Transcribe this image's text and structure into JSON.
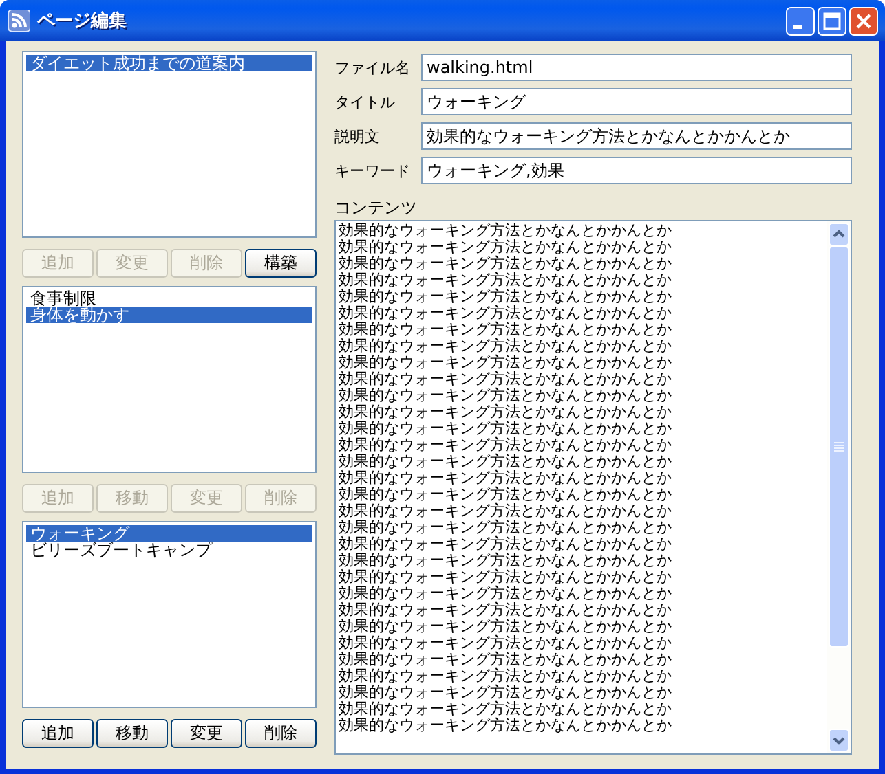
{
  "window": {
    "title": "ページ編集"
  },
  "lists": [
    {
      "items": [
        {
          "label": "ダイエット成功までの道案内",
          "selected": true
        }
      ],
      "buttons": [
        {
          "label": "追加",
          "disabled": true
        },
        {
          "label": "変更",
          "disabled": true
        },
        {
          "label": "削除",
          "disabled": true
        },
        {
          "label": "構築",
          "disabled": false
        }
      ]
    },
    {
      "items": [
        {
          "label": "食事制限",
          "selected": false
        },
        {
          "label": "身体を動かす",
          "selected": true
        }
      ],
      "buttons": [
        {
          "label": "追加",
          "disabled": true
        },
        {
          "label": "移動",
          "disabled": true
        },
        {
          "label": "変更",
          "disabled": true
        },
        {
          "label": "削除",
          "disabled": true
        }
      ]
    },
    {
      "items": [
        {
          "label": "ウォーキング",
          "selected": true
        },
        {
          "label": "ビリーズブートキャンプ",
          "selected": false
        }
      ],
      "buttons": [
        {
          "label": "追加",
          "disabled": false
        },
        {
          "label": "移動",
          "disabled": false
        },
        {
          "label": "変更",
          "disabled": false
        },
        {
          "label": "削除",
          "disabled": false
        }
      ]
    }
  ],
  "fields": [
    {
      "label": "ファイル名",
      "value": "walking.html"
    },
    {
      "label": "タイトル",
      "value": "ウォーキング"
    },
    {
      "label": "説明文",
      "value": "効果的なウォーキング方法とかなんとかかんとか"
    },
    {
      "label": "キーワード",
      "value": "ウォーキング,効果"
    }
  ],
  "content": {
    "label": "コンテンツ",
    "lines": [
      "効果的なウォーキング方法とかなんとかかんとか",
      "効果的なウォーキング方法とかなんとかかんとか",
      "効果的なウォーキング方法とかなんとかかんとか",
      "効果的なウォーキング方法とかなんとかかんとか",
      "効果的なウォーキング方法とかなんとかかんとか",
      "効果的なウォーキング方法とかなんとかかんとか",
      "効果的なウォーキング方法とかなんとかかんとか",
      "効果的なウォーキング方法とかなんとかかんとか",
      "効果的なウォーキング方法とかなんとかかんとか",
      "効果的なウォーキング方法とかなんとかかんとか",
      "効果的なウォーキング方法とかなんとかかんとか",
      "効果的なウォーキング方法とかなんとかかんとか",
      "効果的なウォーキング方法とかなんとかかんとか",
      "効果的なウォーキング方法とかなんとかかんとか",
      "効果的なウォーキング方法とかなんとかかんとか",
      "効果的なウォーキング方法とかなんとかかんとか",
      "効果的なウォーキング方法とかなんとかかんとか",
      "効果的なウォーキング方法とかなんとかかんとか",
      "効果的なウォーキング方法とかなんとかかんとか",
      "効果的なウォーキング方法とかなんとかかんとか",
      "効果的なウォーキング方法とかなんとかかんとか",
      "効果的なウォーキング方法とかなんとかかんとか",
      "効果的なウォーキング方法とかなんとかかんとか",
      "効果的なウォーキング方法とかなんとかかんとか",
      "効果的なウォーキング方法とかなんとかかんとか",
      "効果的なウォーキング方法とかなんとかかんとか",
      "効果的なウォーキング方法とかなんとかかんとか",
      "効果的なウォーキング方法とかなんとかかんとか",
      "効果的なウォーキング方法とかなんとかかんとか",
      "効果的なウォーキング方法とかなんとかかんとか",
      "効果的なウォーキング方法とかなんとかかんとか"
    ]
  }
}
